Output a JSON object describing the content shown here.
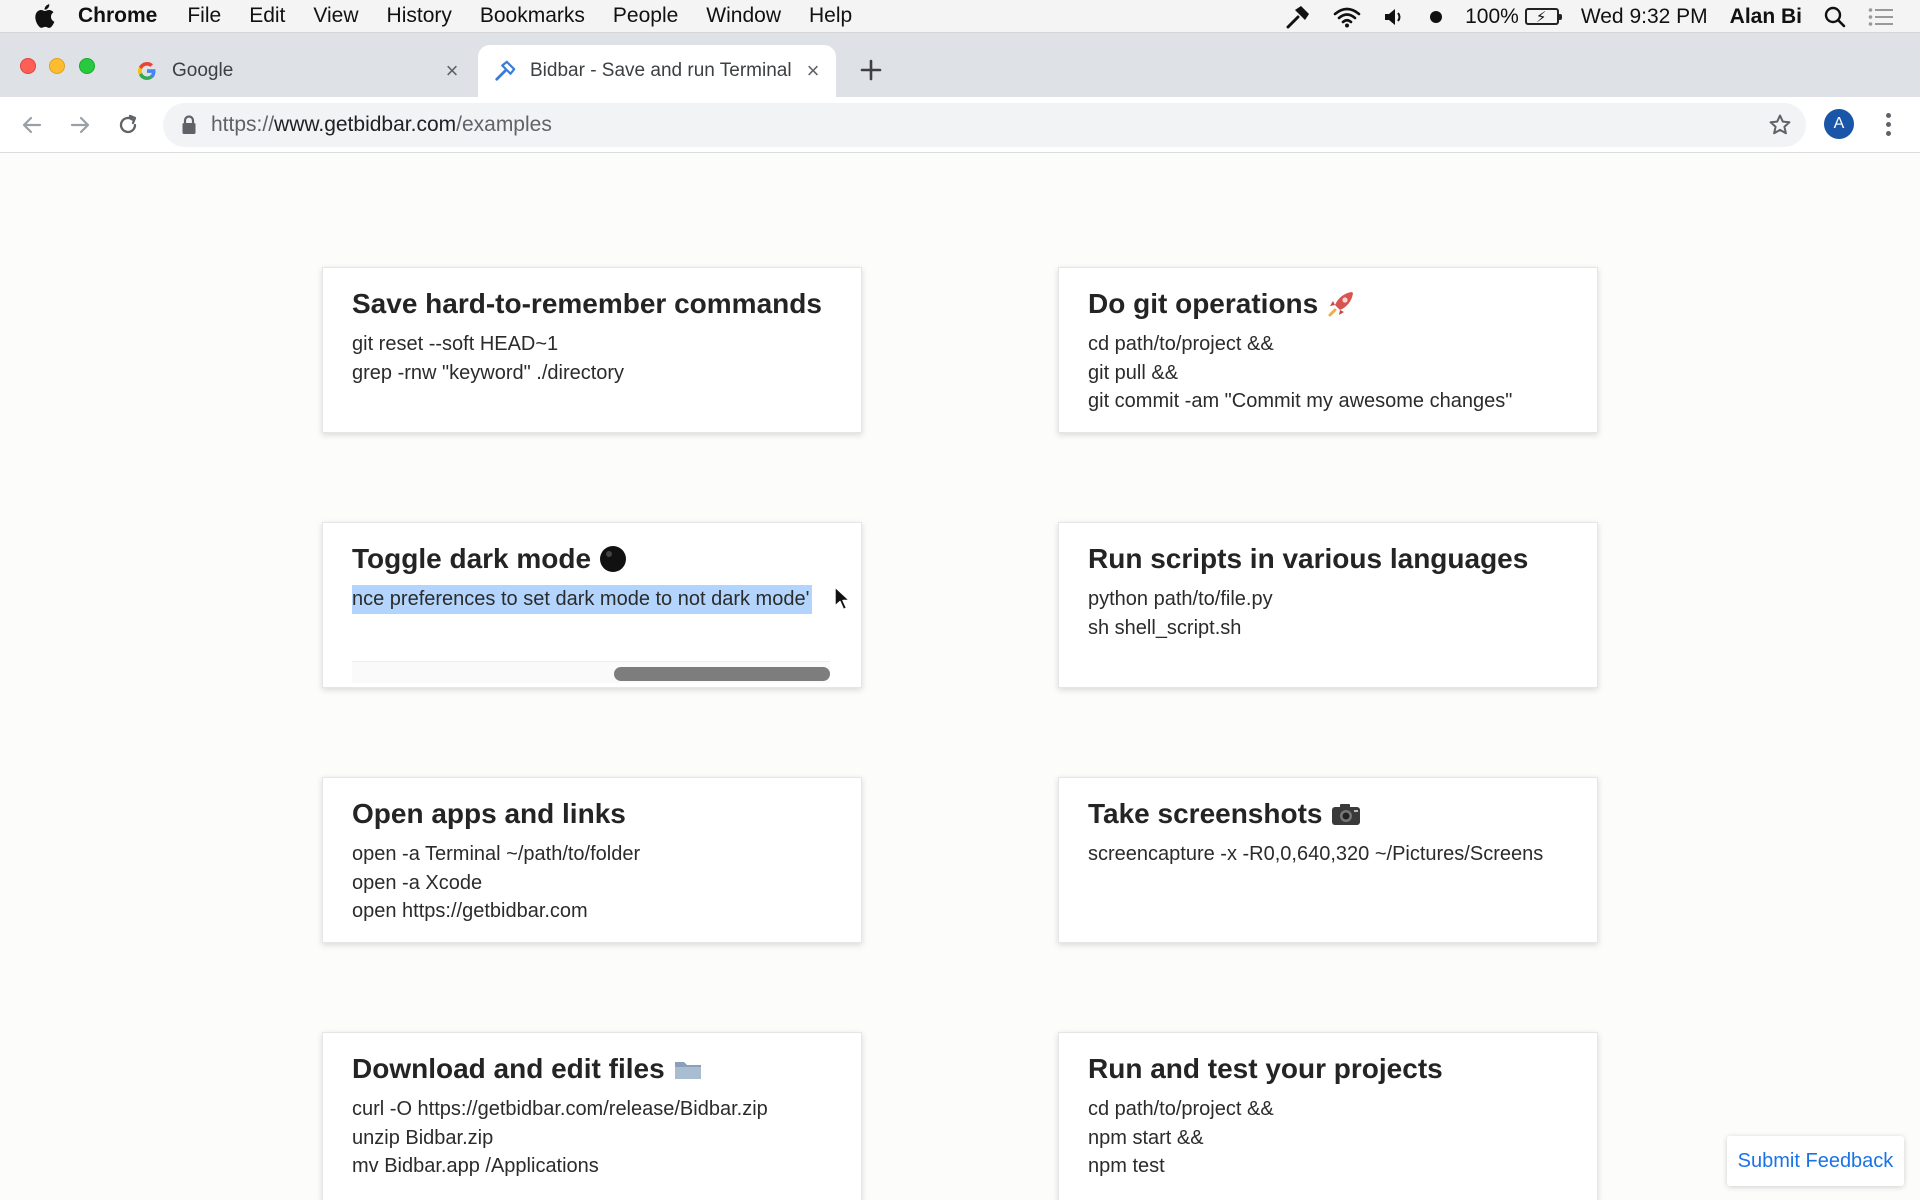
{
  "menubar": {
    "app": "Chrome",
    "items": [
      "File",
      "Edit",
      "View",
      "History",
      "Bookmarks",
      "People",
      "Window",
      "Help"
    ],
    "battery": "100%",
    "clock": "Wed 9:32 PM",
    "user": "Alan Bi"
  },
  "tabs": {
    "google": {
      "title": "Google"
    },
    "bidbar": {
      "title": "Bidbar - Save and run Terminal"
    }
  },
  "address": {
    "scheme": "https://",
    "host": "www.getbidbar.com",
    "path": "/examples"
  },
  "profile": {
    "initial": "A"
  },
  "cards": [
    {
      "title": "Save hard-to-remember commands",
      "lines": [
        "git reset --soft HEAD~1",
        "grep -rnw \"keyword\" ./directory"
      ]
    },
    {
      "title": "Do git operations",
      "emoji": "rocket-icon",
      "lines": [
        "cd path/to/project &&",
        "git pull &&",
        "git commit -am \"Commit my awesome changes\""
      ]
    },
    {
      "title": "Toggle dark mode",
      "emoji": "black-circle-icon",
      "selected_text": "nce preferences to set dark mode to not dark mode'"
    },
    {
      "title": "Run scripts in various languages",
      "lines": [
        "python path/to/file.py",
        "sh shell_script.sh"
      ]
    },
    {
      "title": "Open apps and links",
      "lines": [
        "open -a Terminal ~/path/to/folder",
        "open -a Xcode",
        "open https://getbidbar.com"
      ]
    },
    {
      "title": "Take screenshots",
      "emoji": "camera-icon",
      "lines": [
        "screencapture -x -R0,0,640,320 ~/Pictures/Screens"
      ]
    },
    {
      "title": "Download and edit files",
      "emoji": "folder-icon",
      "lines": [
        "curl -O https://getbidbar.com/release/Bidbar.zip",
        "unzip Bidbar.zip",
        "mv Bidbar.app /Applications"
      ]
    },
    {
      "title": "Run and test your projects",
      "lines": [
        "cd path/to/project &&",
        "npm start &&",
        "npm test"
      ]
    }
  ],
  "feedback": {
    "label": "Submit Feedback"
  },
  "colors": {
    "selection": "#b3d4fc",
    "link": "#1a73e8",
    "avatar": "#1a56a8"
  }
}
